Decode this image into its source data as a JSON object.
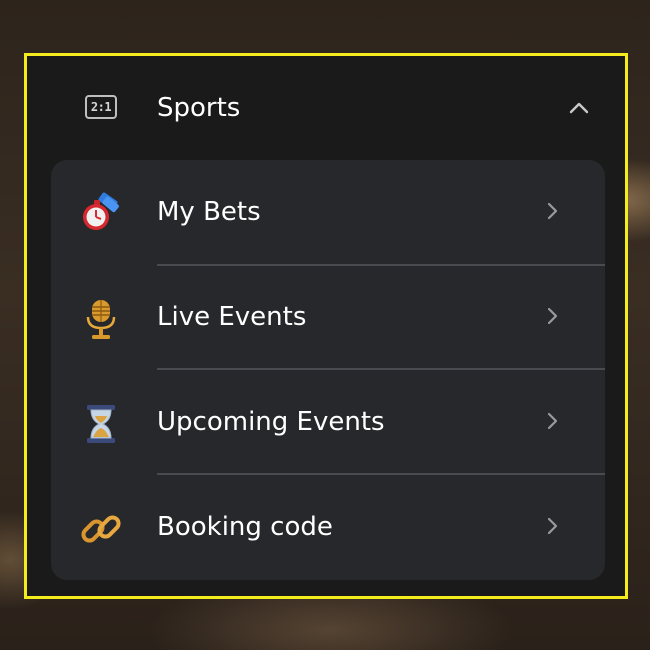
{
  "menu": {
    "header": {
      "title": "Sports",
      "icon_text": "2:1",
      "icon": "scoreboard-icon",
      "toggle_icon": "chevron-up-icon"
    },
    "items": [
      {
        "label": "My Bets",
        "icon": "stopwatch-ticket-icon"
      },
      {
        "label": "Live Events",
        "icon": "microphone-icon"
      },
      {
        "label": "Upcoming Events",
        "icon": "hourglass-icon"
      },
      {
        "label": "Booking code",
        "icon": "chain-link-icon"
      }
    ]
  },
  "colors": {
    "highlight_border": "#f5ec1e",
    "panel_bg": "#1a1a1b",
    "card_bg": "#27282c",
    "text": "#ffffff",
    "chevron": "#9a9a9e"
  }
}
